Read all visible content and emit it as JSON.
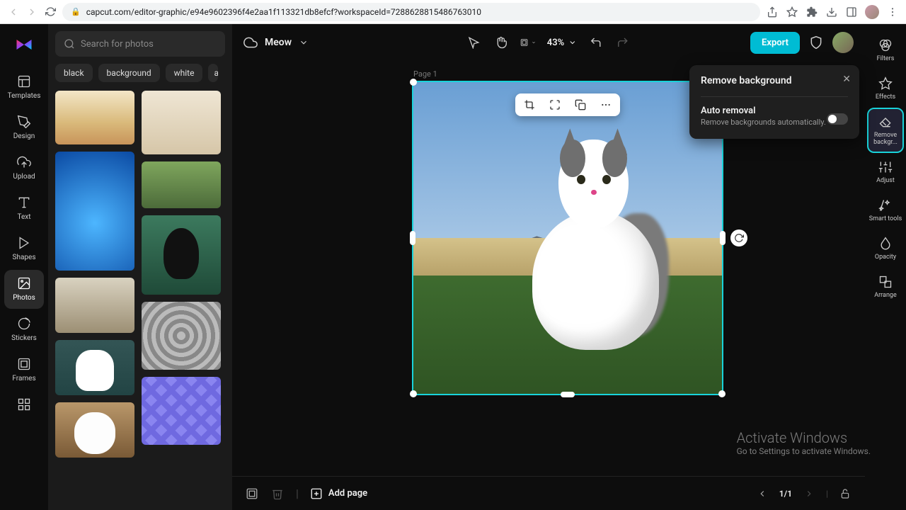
{
  "browser": {
    "url": "capcut.com/editor-graphic/e94e9602396f4e2aa1f113321db8efcf?workspaceId=7288628815486763010"
  },
  "left_rail": {
    "items": [
      {
        "label": "Templates"
      },
      {
        "label": "Design"
      },
      {
        "label": "Upload"
      },
      {
        "label": "Text"
      },
      {
        "label": "Shapes"
      },
      {
        "label": "Photos"
      },
      {
        "label": "Stickers"
      },
      {
        "label": "Frames"
      }
    ]
  },
  "photos_panel": {
    "search_placeholder": "Search for photos",
    "chips": [
      "black",
      "background",
      "white",
      "a"
    ]
  },
  "top_bar": {
    "project_name": "Meow",
    "zoom": "43%",
    "export_label": "Export"
  },
  "canvas": {
    "page_label": "Page 1"
  },
  "popup": {
    "title": "Remove background",
    "sub_title": "Auto removal",
    "sub_desc": "Remove backgrounds automatically."
  },
  "right_rail": {
    "items": [
      {
        "label": "Filters"
      },
      {
        "label": "Effects"
      },
      {
        "label": "Remove backgr..."
      },
      {
        "label": "Adjust"
      },
      {
        "label": "Smart tools"
      },
      {
        "label": "Opacity"
      },
      {
        "label": "Arrange"
      }
    ]
  },
  "bottom_bar": {
    "add_page": "Add page",
    "page_indicator": "1/1"
  },
  "watermark": {
    "title": "Activate Windows",
    "subtitle": "Go to Settings to activate Windows."
  }
}
